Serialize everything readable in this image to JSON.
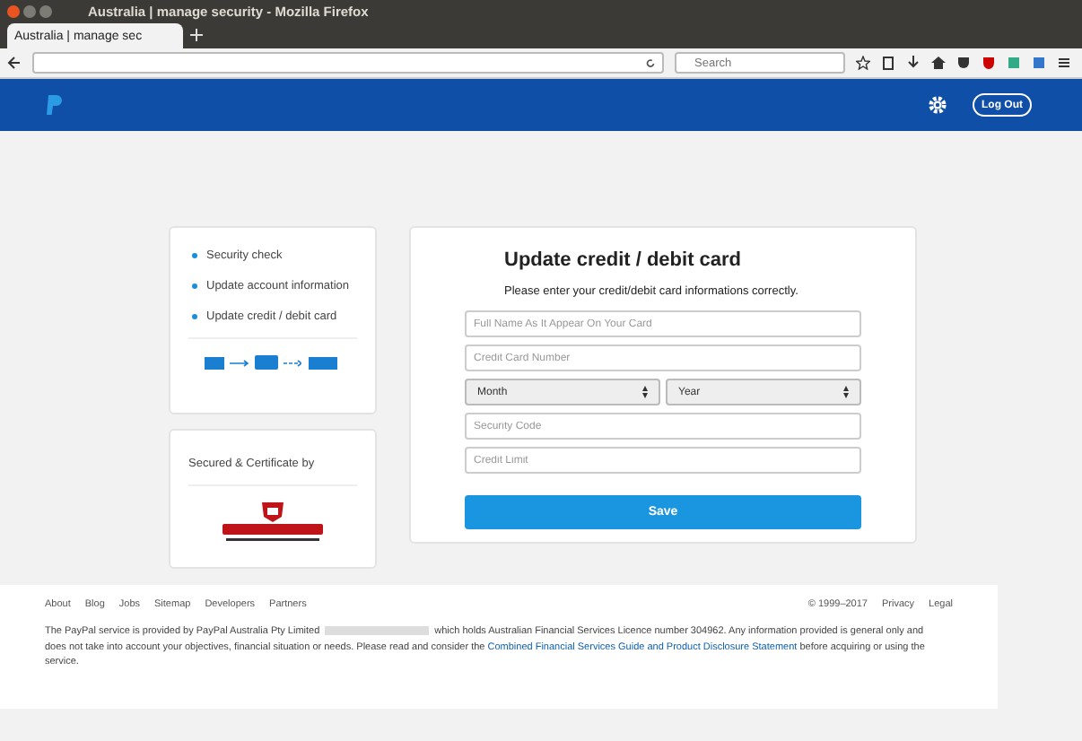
{
  "window": {
    "title": "Australia | manage security - Mozilla Firefox"
  },
  "browser": {
    "tab_title": "Australia | manage sec",
    "search_placeholder": "Search"
  },
  "header": {
    "logout_label": "Log Out"
  },
  "steps": [
    {
      "label": "Security check"
    },
    {
      "label": "Update account information"
    },
    {
      "label": "Update credit / debit card"
    }
  ],
  "certificate": {
    "heading": "Secured & Certificate by"
  },
  "form": {
    "title": "Update credit / debit card",
    "subtitle": "Please enter your credit/debit card informations correctly.",
    "fields": [
      {
        "kind": "text",
        "placeholder": "Full Name As It Appear On Your Card"
      },
      {
        "kind": "text",
        "placeholder": "Credit Card Number"
      },
      {
        "kind": "selects",
        "options": [
          "Month",
          "Year"
        ]
      },
      {
        "kind": "text",
        "placeholder": "Security Code"
      },
      {
        "kind": "text",
        "placeholder": "Credit Limit"
      }
    ],
    "submit_label": "Save"
  },
  "footer": {
    "links": [
      "About",
      "Blog",
      "Jobs",
      "Sitemap",
      "Developers",
      "Partners"
    ],
    "copyright": "© 1999–2017",
    "legal_links": [
      "Privacy",
      "Legal"
    ],
    "disclaimer_before": "The PayPal service is provided by PayPal Australia Pty Limited",
    "disclaimer_middle": "which holds Australian Financial Services Licence number 304962. Any information provided is general only and does not take into account your objectives, financial situation or needs. Please read and consider the",
    "disclaimer_link": "Combined Financial Services Guide and Product Disclosure Statement",
    "disclaimer_after": "before acquiring or using the service."
  }
}
